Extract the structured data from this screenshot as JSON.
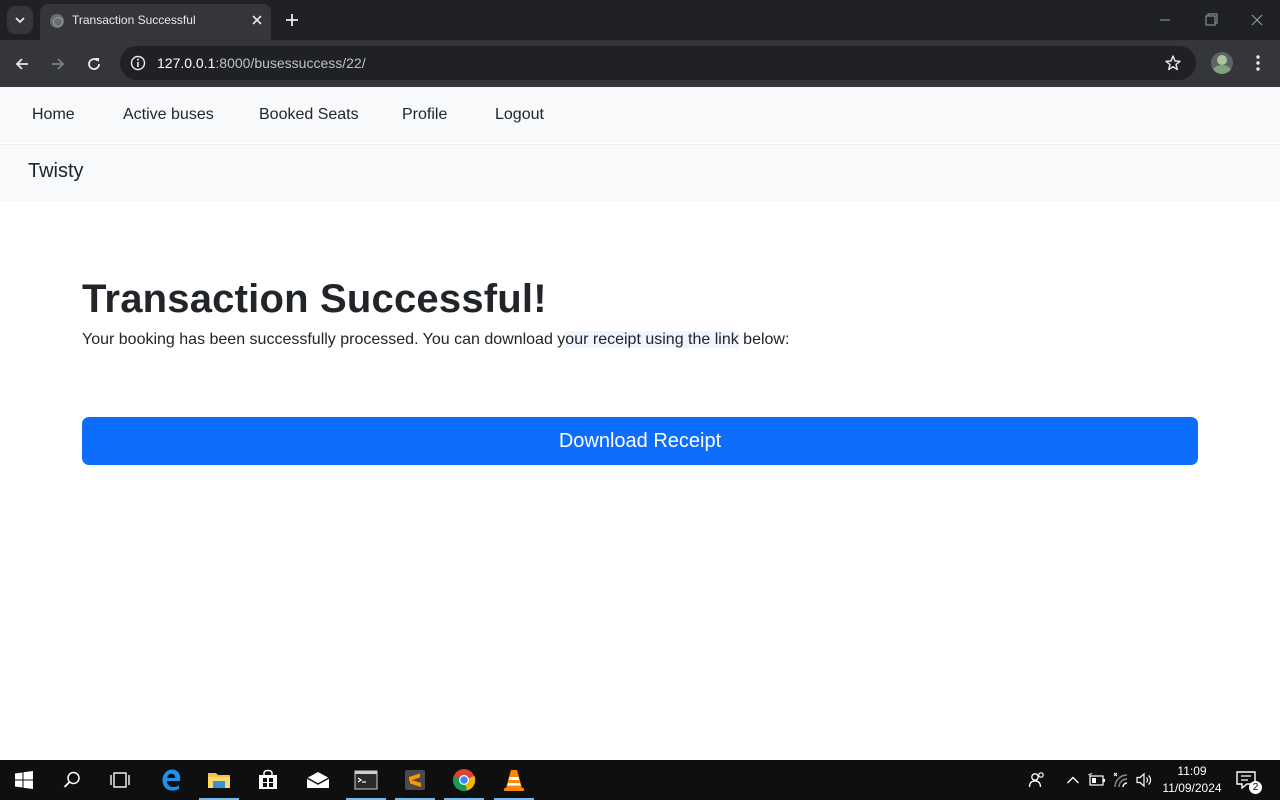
{
  "browser": {
    "tab_title": "Transaction Successful",
    "url_host": "127.0.0.1",
    "url_path": ":8000/busessuccess/22/"
  },
  "navbar": {
    "links": [
      "Home",
      "Active buses",
      "Booked Seats",
      "Profile",
      "Logout"
    ]
  },
  "brand": "Twisty",
  "main": {
    "heading": "Transaction Successful!",
    "message_part1": "Your booking has been successfully processed. You can download y",
    "message_highlight": "our receipt using the link",
    "message_part2": " below:",
    "download_button": "Download Receipt"
  },
  "taskbar": {
    "time": "11:09",
    "date": "11/09/2024",
    "notification_count": "2"
  },
  "colors": {
    "primary": "#0d6efd",
    "navbar_bg": "#f8f9fa",
    "chrome_dark": "#202124",
    "chrome_toolbar": "#35363a"
  }
}
